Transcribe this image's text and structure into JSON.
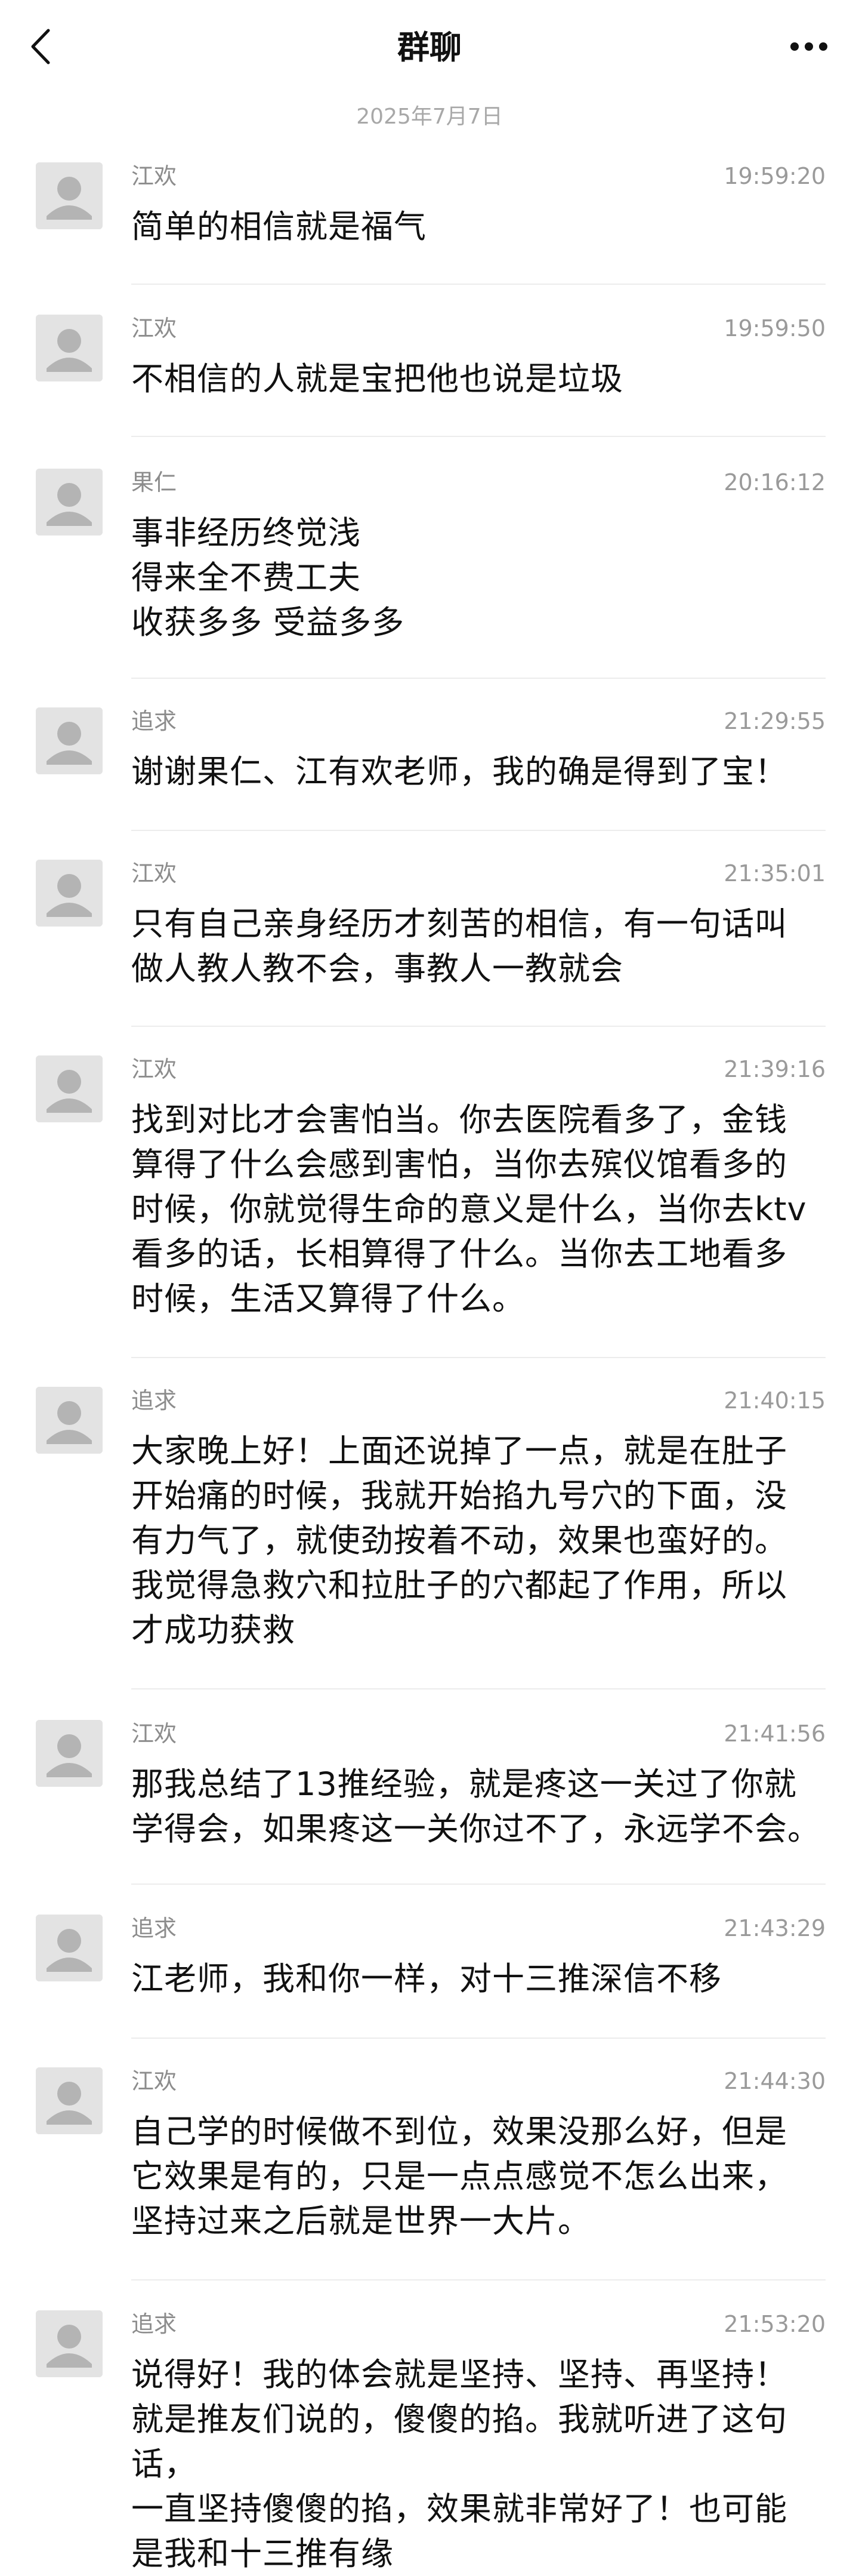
{
  "header": {
    "title": "群聊",
    "back_icon": "chevron-left-icon",
    "more_icon": "more-dots-icon"
  },
  "date_separator": "2025年7月7日",
  "messages": [
    {
      "sender": "江欢",
      "time": "19:59:20",
      "text": "简单的相信就是福气"
    },
    {
      "sender": "江欢",
      "time": "19:59:50",
      "text": "不相信的人就是宝把他也说是垃圾"
    },
    {
      "sender": "果仁",
      "time": "20:16:12",
      "text": "事非经历终觉浅\n得来全不费工夫\n收获多多 受益多多"
    },
    {
      "sender": "追求",
      "time": "21:29:55",
      "text": "谢谢果仁、江有欢老师，我的确是得到了宝！"
    },
    {
      "sender": "江欢",
      "time": "21:35:01",
      "text": "只有自己亲身经历才刻苦的相信，有一句话叫\n做人教人教不会，事教人一教就会"
    },
    {
      "sender": "江欢",
      "time": "21:39:16",
      "text": "找到对比才会害怕当。你去医院看多了，金钱\n算得了什么会感到害怕，当你去殡仪馆看多的\n时候，你就觉得生命的意义是什么，当你去ktv\n看多的话，长相算得了什么。当你去工地看多\n时候，生活又算得了什么。"
    },
    {
      "sender": "追求",
      "time": "21:40:15",
      "text": "大家晚上好！上面还说掉了一点，就是在肚子\n开始痛的时候，我就开始掐九号穴的下面，没\n有力气了，就使劲按着不动，效果也蛮好的。\n我觉得急救穴和拉肚子的穴都起了作用，所以\n才成功获救"
    },
    {
      "sender": "江欢",
      "time": "21:41:56",
      "text": "那我总结了13推经验，就是疼这一关过了你就\n学得会，如果疼这一关你过不了，永远学不会。"
    },
    {
      "sender": "追求",
      "time": "21:43:29",
      "text": "江老师，我和你一样，对十三推深信不移"
    },
    {
      "sender": "江欢",
      "time": "21:44:30",
      "text": "自己学的时候做不到位，效果没那么好，但是\n它效果是有的，只是一点点感觉不怎么出来，\n坚持过来之后就是世界一大片。"
    },
    {
      "sender": "追求",
      "time": "21:53:20",
      "text": "说得好！我的体会就是坚持、坚持、再坚持！\n就是推友们说的，傻傻的掐。我就听进了这句话，\n一直坚持傻傻的掐，效果就非常好了！也可能\n是我和十三推有缘"
    }
  ]
}
